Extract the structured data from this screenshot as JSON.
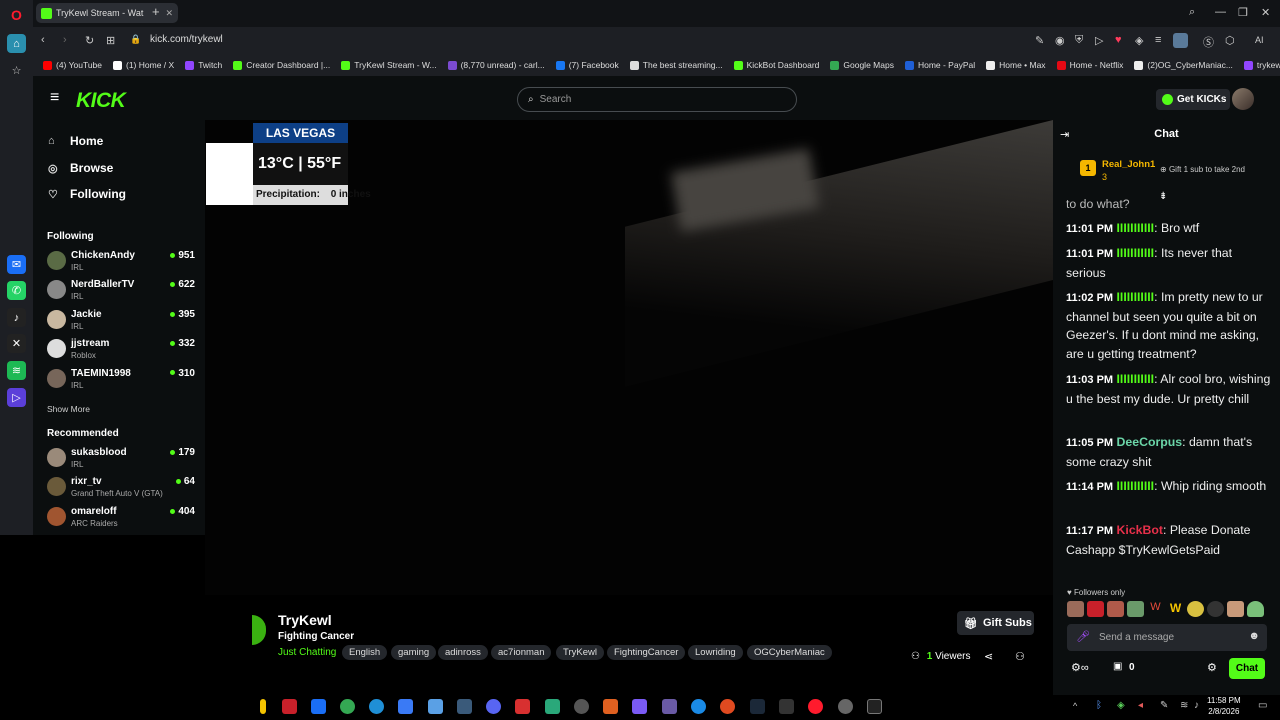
{
  "browser": {
    "tab_title": "TryKewl Stream - Wat",
    "url": "kick.com/trykewl",
    "bookmarks": [
      {
        "label": "(4) YouTube",
        "color": "#ff0000"
      },
      {
        "label": "(1) Home / X",
        "color": "#ffffff"
      },
      {
        "label": "Twitch",
        "color": "#9146ff"
      },
      {
        "label": "Creator Dashboard |...",
        "color": "#53fc18"
      },
      {
        "label": "TryKewl Stream - W...",
        "color": "#53fc18"
      },
      {
        "label": "(8,770 unread) - carl...",
        "color": "#7b4bd1"
      },
      {
        "label": "(7) Facebook",
        "color": "#1877f2"
      },
      {
        "label": "The best streaming...",
        "color": "#dddddd"
      },
      {
        "label": "KickBot Dashboard",
        "color": "#53fc18"
      },
      {
        "label": "Google Maps",
        "color": "#34a853"
      },
      {
        "label": "Home - PayPal",
        "color": "#1f5fd6"
      },
      {
        "label": "Home • Max",
        "color": "#eeeeee"
      },
      {
        "label": "Home - Netflix",
        "color": "#e50914"
      },
      {
        "label": "(2)OG_CyberManiac...",
        "color": "#eeeeee"
      },
      {
        "label": "trykewl - Twitch",
        "color": "#9146ff"
      }
    ],
    "ai_label": "AI"
  },
  "header": {
    "logo": "KICK",
    "search_placeholder": "Search",
    "get_kicks_label": "Get KICKs"
  },
  "sidebar": {
    "nav": [
      {
        "label": "Home",
        "icon": "home-icon"
      },
      {
        "label": "Browse",
        "icon": "browse-icon"
      },
      {
        "label": "Following",
        "icon": "heart-icon"
      }
    ],
    "following_title": "Following",
    "following": [
      {
        "name": "ChickenAndy",
        "category": "IRL",
        "viewers": "951",
        "color": "#5a6b45"
      },
      {
        "name": "NerdBallerTV",
        "category": "IRL",
        "viewers": "622",
        "color": "#888888"
      },
      {
        "name": "Jackie",
        "category": "IRL",
        "viewers": "395",
        "color": "#c9b8a0"
      },
      {
        "name": "jjstream",
        "category": "Roblox",
        "viewers": "332",
        "color": "#dddddd"
      },
      {
        "name": "TAEMIN1998",
        "category": "IRL",
        "viewers": "310",
        "color": "#77665a"
      }
    ],
    "show_more": "Show More",
    "recommended_title": "Recommended",
    "recommended": [
      {
        "name": "sukasblood",
        "category": "IRL",
        "viewers": "179",
        "color": "#9a8a7a"
      },
      {
        "name": "rixr_tv",
        "category": "Grand Theft Auto V (GTA)",
        "viewers": "64",
        "color": "#6a5a3a"
      },
      {
        "name": "omareloff",
        "category": "ARC Raiders",
        "viewers": "404",
        "color": "#a05530"
      }
    ]
  },
  "video_overlay": {
    "city": "LAS VEGAS",
    "temperature": "13°C | 55°F",
    "precip_label": "Precipitation:",
    "precip_value": "0 inches"
  },
  "stream": {
    "streamer": "TryKewl",
    "title": "Fighting Cancer",
    "category": "Just Chatting",
    "tags": [
      "English",
      "gaming",
      "adinross",
      "ac7ionman",
      "TryKewl",
      "FightingCancer",
      "Lowriding",
      "OGCyberManiac"
    ],
    "gift_subs_label": "Gift Subs",
    "viewer_count": "1",
    "viewers_label": "Viewers"
  },
  "chat": {
    "title": "Chat",
    "pinned_user": "Real_John1",
    "pinned_rank": "3",
    "pinned_note": "Gift 1 sub to take 2nd",
    "partial_line": "to do what?",
    "messages": [
      {
        "time": "11:01 PM",
        "user": "IIIIIIIIIII",
        "user_color": "#53fc18",
        "text": "Bro wtf"
      },
      {
        "time": "11:01 PM",
        "user": "IIIIIIIIIII",
        "user_color": "#53fc18",
        "text": "Its never that serious"
      },
      {
        "time": "11:02 PM",
        "user": "IIIIIIIIIII",
        "user_color": "#53fc18",
        "text": "Im pretty new to ur channel but seen you quite a bit on Geezer's. If u dont mind me asking, are u getting treatment?"
      },
      {
        "time": "11:03 PM",
        "user": "IIIIIIIIIII",
        "user_color": "#53fc18",
        "text": "Alr cool bro, wishing u the best my dude. Ur pretty chill"
      },
      {
        "time": "11:05 PM",
        "user": "DeeCorpus",
        "user_color": "#6bd5a8",
        "text": "damn that's some crazy shit"
      },
      {
        "time": "11:14 PM",
        "user": "IIIIIIIIIII",
        "user_color": "#53fc18",
        "text": "Whip riding smooth"
      },
      {
        "time": "11:17 PM",
        "user": "KickBot",
        "user_color": "#e8304a",
        "text": "Please Donate Cashapp $TryKewlGetsPaid"
      }
    ],
    "followers_only": "Followers only",
    "input_placeholder": "Send a message",
    "points_count": "0",
    "chat_button": "Chat"
  },
  "taskbar": {
    "time": "11:58 PM",
    "date": "2/8/2026"
  }
}
